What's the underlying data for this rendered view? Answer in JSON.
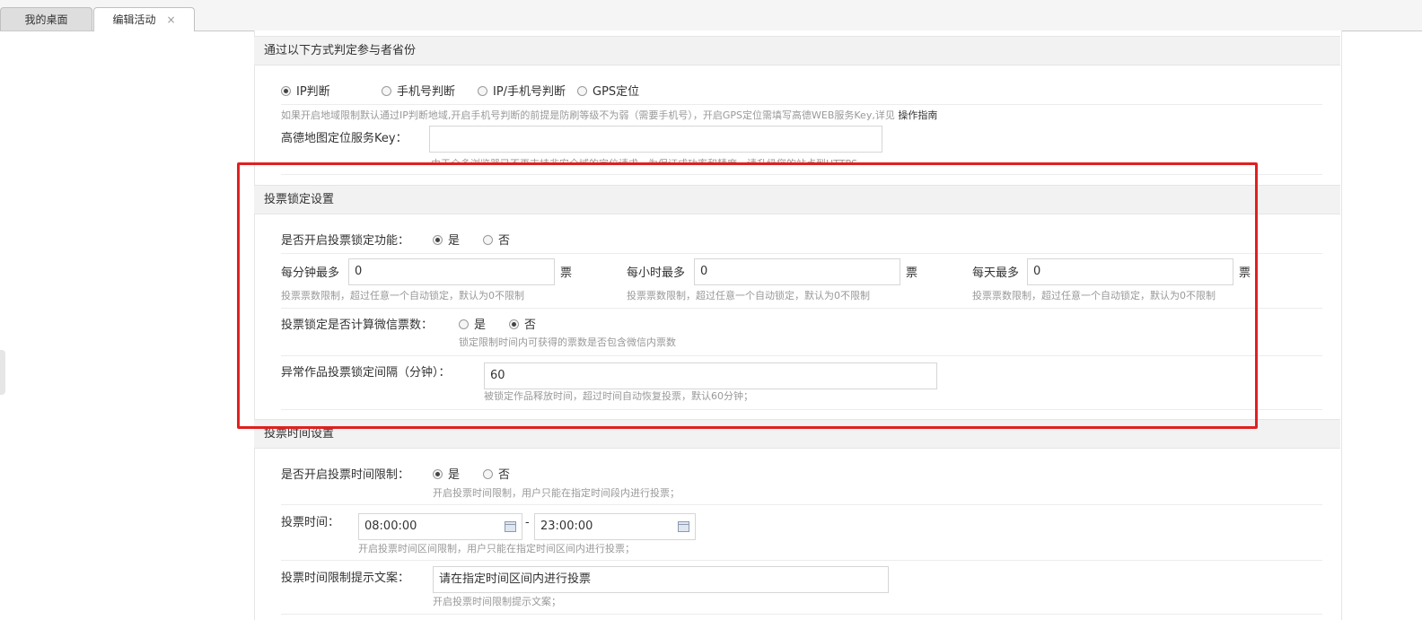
{
  "tabs": {
    "home": "我的桌面",
    "edit": "编辑活动",
    "close": "×"
  },
  "region": {
    "title": "通过以下方式判定参与者省份",
    "options": [
      "IP判断",
      "手机号判断",
      "IP/手机号判断",
      "GPS定位"
    ],
    "selected": 0,
    "hint": "如果开启地域限制默认通过IP判断地域,开启手机号判断的前提是防刷等级不为弱（需要手机号），开启GPS定位需填写高德WEB服务Key,详见",
    "guide_link": "操作指南",
    "key_label": "高德地图定位服务Key：",
    "key_value": "",
    "key_hint": "由于众多浏览器已不再支持非安全域的定位请求，为保证成功率和精度，请升级您的站点到HTTPS"
  },
  "lock": {
    "title": "投票锁定设置",
    "enable_label": "是否开启投票锁定功能：",
    "yes": "是",
    "no": "否",
    "per_minute_label": "每分钟最多",
    "per_minute_value": "0",
    "per_hour_label": "每小时最多",
    "per_hour_value": "0",
    "per_day_label": "每天最多",
    "per_day_value": "0",
    "unit": "票",
    "limit_hint": "投票票数限制，超过任意一个自动锁定，默认为0不限制",
    "wechat_label": "投票锁定是否计算微信票数：",
    "wechat_hint": "锁定限制时间内可获得的票数是否包含微信内票数",
    "interval_label": "异常作品投票锁定间隔（分钟）：",
    "interval_value": "60",
    "interval_hint": "被锁定作品释放时间，超过时间自动恢复投票，默认60分钟；"
  },
  "time": {
    "title": "投票时间设置",
    "enable_label": "是否开启投票时间限制：",
    "yes": "是",
    "no": "否",
    "enable_hint": "开启投票时间限制，用户只能在指定时间段内进行投票；",
    "time_label": "投票时间：",
    "start": "08:00:00",
    "dash": "-",
    "end": "23:00:00",
    "time_hint": "开启投票时间区间限制，用户只能在指定时间区间内进行投票；",
    "tip_label": "投票时间限制提示文案：",
    "tip_value": "请在指定时间区间内进行投票",
    "tip_hint": "开启投票时间限制提示文案；"
  }
}
